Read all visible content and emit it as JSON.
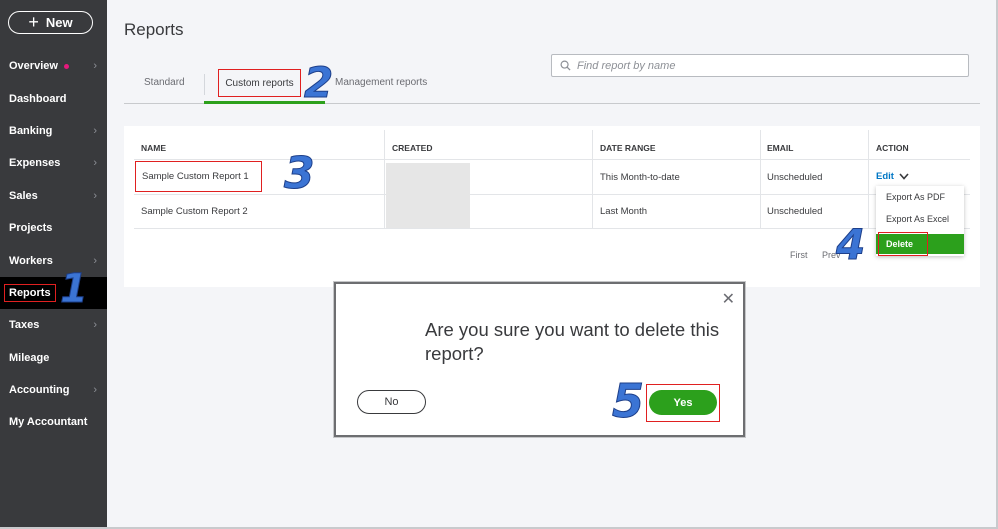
{
  "sidebar": {
    "new_label": "New",
    "items": [
      {
        "label": "Overview",
        "has_chevron": true,
        "has_dot": true
      },
      {
        "label": "Dashboard",
        "has_chevron": false
      },
      {
        "label": "Banking",
        "has_chevron": true
      },
      {
        "label": "Expenses",
        "has_chevron": true
      },
      {
        "label": "Sales",
        "has_chevron": true
      },
      {
        "label": "Projects",
        "has_chevron": false
      },
      {
        "label": "Workers",
        "has_chevron": true
      },
      {
        "label": "Reports",
        "has_chevron": false,
        "active": true
      },
      {
        "label": "Taxes",
        "has_chevron": true
      },
      {
        "label": "Mileage",
        "has_chevron": false
      },
      {
        "label": "Accounting",
        "has_chevron": true
      },
      {
        "label": "My Accountant",
        "has_chevron": false
      }
    ]
  },
  "page": {
    "title": "Reports",
    "search_placeholder": "Find report by name"
  },
  "tabs": {
    "standard": "Standard",
    "custom": "Custom reports",
    "management": "Management reports",
    "active": "custom"
  },
  "table": {
    "headers": {
      "name": "NAME",
      "created": "CREATED",
      "date_range": "DATE RANGE",
      "email": "EMAIL",
      "action": "ACTION"
    },
    "rows": [
      {
        "name": "Sample Custom Report 1",
        "date_range": "This Month-to-date",
        "email": "Unscheduled",
        "action": "Edit"
      },
      {
        "name": "Sample Custom Report 2",
        "date_range": "Last Month",
        "email": "Unscheduled"
      }
    ],
    "pager": {
      "first": "First",
      "prev": "Prev"
    }
  },
  "action_menu": {
    "items": [
      "Export As PDF",
      "Export As Excel"
    ],
    "delete": "Delete"
  },
  "modal": {
    "question": "Are you sure you want to delete this report?",
    "no_label": "No",
    "yes_label": "Yes",
    "close_glyph": "✕"
  },
  "annotations": {
    "step1": "1",
    "step2": "2",
    "step3": "3",
    "step4": "4",
    "step5": "5"
  },
  "colors": {
    "sidebar_bg": "#393a3d",
    "accent_green": "#2ca01c",
    "link_blue": "#0077c5",
    "highlight_red": "#e02020",
    "annotation_blue": "#3b74d4"
  }
}
